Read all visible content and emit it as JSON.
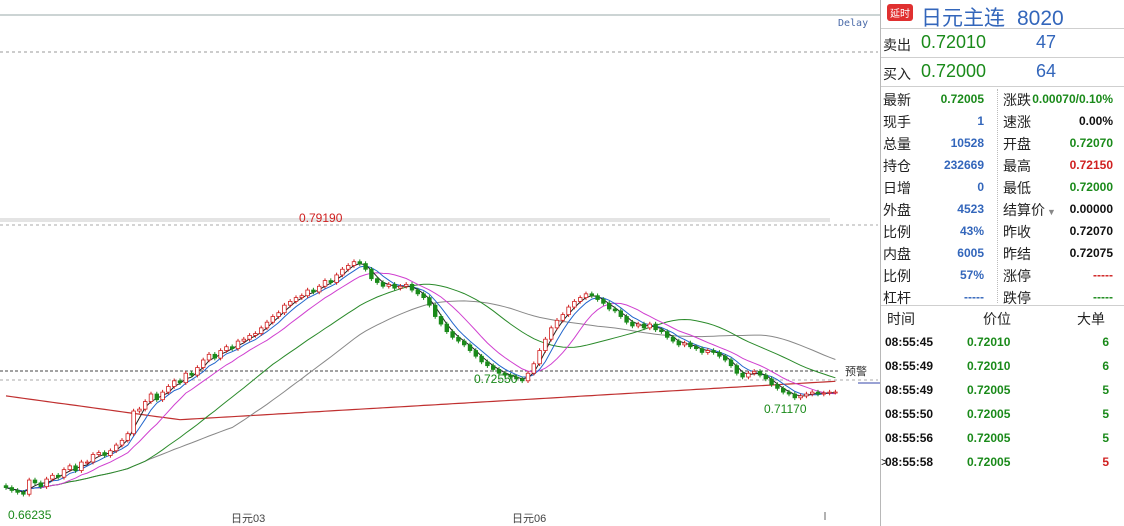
{
  "chart": {
    "delay_label": "Delay",
    "high_label": "0.79190",
    "mid_low_label": "0.72550",
    "recent_low_label": "0.71170",
    "low_label": "0.66235",
    "date_labels": [
      "日元03",
      "日元06"
    ],
    "alert_label": "预警"
  },
  "chart_data": {
    "type": "candlestick",
    "price_range": [
      0.655,
      0.81
    ],
    "open": [
      0.6705,
      0.6695,
      0.668,
      0.667,
      0.666,
      0.6735,
      0.672,
      0.67,
      0.674,
      0.676,
      0.675,
      0.679,
      0.681,
      0.6785,
      0.683,
      0.683,
      0.687,
      0.688,
      0.6865,
      0.689,
      0.692,
      0.6945,
      0.698,
      0.71,
      0.711,
      0.715,
      0.719,
      0.716,
      0.72,
      0.723,
      0.726,
      0.725,
      0.73,
      0.729,
      0.733,
      0.737,
      0.74,
      0.738,
      0.742,
      0.744,
      0.743,
      0.747,
      0.748,
      0.75,
      0.751,
      0.754,
      0.757,
      0.76,
      0.762,
      0.766,
      0.768,
      0.77,
      0.771,
      0.774,
      0.773,
      0.776,
      0.779,
      0.778,
      0.782,
      0.785,
      0.787,
      0.789,
      0.788,
      0.785,
      0.78,
      0.778,
      0.776,
      0.777,
      0.775,
      0.776,
      0.777,
      0.774,
      0.772,
      0.77,
      0.766,
      0.76,
      0.756,
      0.752,
      0.749,
      0.747,
      0.745,
      0.742,
      0.739,
      0.736,
      0.734,
      0.732,
      0.73,
      0.729,
      0.728,
      0.727,
      0.726,
      0.73,
      0.735,
      0.742,
      0.748,
      0.754,
      0.758,
      0.761,
      0.765,
      0.768,
      0.77,
      0.772,
      0.771,
      0.769,
      0.767,
      0.764,
      0.763,
      0.76,
      0.757,
      0.755,
      0.756,
      0.754,
      0.756,
      0.753,
      0.752,
      0.749,
      0.747,
      0.745,
      0.746,
      0.744,
      0.743,
      0.741,
      0.742,
      0.741,
      0.739,
      0.737,
      0.734,
      0.73,
      0.728,
      0.73,
      0.731,
      0.729,
      0.727,
      0.724,
      0.722,
      0.72,
      0.719,
      0.717,
      0.718,
      0.719,
      0.72,
      0.719,
      0.7195,
      0.72
    ],
    "close": [
      0.6695,
      0.668,
      0.667,
      0.666,
      0.6735,
      0.672,
      0.67,
      0.674,
      0.676,
      0.675,
      0.679,
      0.681,
      0.6785,
      0.683,
      0.683,
      0.687,
      0.688,
      0.6865,
      0.689,
      0.692,
      0.6945,
      0.698,
      0.71,
      0.711,
      0.715,
      0.719,
      0.716,
      0.72,
      0.723,
      0.726,
      0.725,
      0.73,
      0.729,
      0.733,
      0.737,
      0.74,
      0.738,
      0.742,
      0.744,
      0.743,
      0.747,
      0.748,
      0.75,
      0.751,
      0.754,
      0.757,
      0.76,
      0.762,
      0.766,
      0.768,
      0.77,
      0.771,
      0.774,
      0.773,
      0.776,
      0.779,
      0.778,
      0.782,
      0.785,
      0.787,
      0.789,
      0.788,
      0.785,
      0.78,
      0.778,
      0.776,
      0.777,
      0.775,
      0.776,
      0.777,
      0.774,
      0.772,
      0.77,
      0.766,
      0.76,
      0.756,
      0.752,
      0.749,
      0.747,
      0.745,
      0.742,
      0.739,
      0.736,
      0.734,
      0.732,
      0.73,
      0.729,
      0.728,
      0.727,
      0.726,
      0.73,
      0.735,
      0.742,
      0.748,
      0.754,
      0.758,
      0.761,
      0.765,
      0.768,
      0.77,
      0.772,
      0.771,
      0.769,
      0.767,
      0.764,
      0.763,
      0.76,
      0.757,
      0.755,
      0.756,
      0.754,
      0.756,
      0.753,
      0.752,
      0.749,
      0.747,
      0.745,
      0.746,
      0.744,
      0.743,
      0.741,
      0.742,
      0.741,
      0.739,
      0.737,
      0.734,
      0.73,
      0.728,
      0.73,
      0.731,
      0.729,
      0.727,
      0.724,
      0.722,
      0.72,
      0.719,
      0.717,
      0.718,
      0.719,
      0.72,
      0.719,
      0.7195,
      0.72,
      0.72005
    ],
    "high_marker": 0.7919,
    "low_marker": 0.66235,
    "alert_price": 0.7235
  },
  "quote": {
    "delay_badge": "延时",
    "name": "日元主连",
    "code": "8020",
    "sell_label": "卖出",
    "sell_price": "0.72010",
    "sell_vol": "47",
    "buy_label": "买入",
    "buy_price": "0.72000",
    "buy_vol": "64",
    "stats_left": [
      {
        "k": "最新",
        "v": "0.72005",
        "c": "green"
      },
      {
        "k": "现手",
        "v": "1",
        "c": "blue"
      },
      {
        "k": "总量",
        "v": "10528",
        "c": "blue"
      },
      {
        "k": "持仓",
        "v": "232669",
        "c": "blue"
      },
      {
        "k": "日增",
        "v": "0",
        "c": "blue"
      },
      {
        "k": "外盘",
        "v": "4523",
        "c": "blue"
      },
      {
        "k": "比例",
        "v": "43%",
        "c": "blue"
      },
      {
        "k": "内盘",
        "v": "6005",
        "c": "blue"
      },
      {
        "k": "比例",
        "v": "57%",
        "c": "blue"
      },
      {
        "k": "杠杆",
        "v": "-----",
        "c": "blue"
      }
    ],
    "stats_right": [
      {
        "k": "涨跌",
        "v": "0.00070/0.10%",
        "c": "green"
      },
      {
        "k": "速涨",
        "v": "0.00%",
        "c": "black"
      },
      {
        "k": "开盘",
        "v": "0.72070",
        "c": "green"
      },
      {
        "k": "最高",
        "v": "0.72150",
        "c": "red"
      },
      {
        "k": "最低",
        "v": "0.72000",
        "c": "green"
      },
      {
        "k": "结算价",
        "v": "0.00000",
        "c": "black"
      },
      {
        "k": "昨收",
        "v": "0.72070",
        "c": "black"
      },
      {
        "k": "昨结",
        "v": "0.72075",
        "c": "black"
      },
      {
        "k": "涨停",
        "v": "-----",
        "c": "red"
      },
      {
        "k": "跌停",
        "v": "-----",
        "c": "green"
      }
    ],
    "ticks_header": {
      "time": "时间",
      "price": "价位",
      "vol": "大单"
    },
    "ticks": [
      {
        "time": "08:55:45",
        "price": "0.72010",
        "vol": "6",
        "c": "green"
      },
      {
        "time": "08:55:49",
        "price": "0.72010",
        "vol": "6",
        "c": "green"
      },
      {
        "time": "08:55:49",
        "price": "0.72005",
        "vol": "5",
        "c": "green"
      },
      {
        "time": "08:55:50",
        "price": "0.72005",
        "vol": "5",
        "c": "green"
      },
      {
        "time": "08:55:56",
        "price": "0.72005",
        "vol": "5",
        "c": "green"
      },
      {
        "time": "08:55:58",
        "price": "0.72005",
        "vol": "5",
        "c": "red"
      }
    ],
    "last_tick_marker": ">"
  }
}
